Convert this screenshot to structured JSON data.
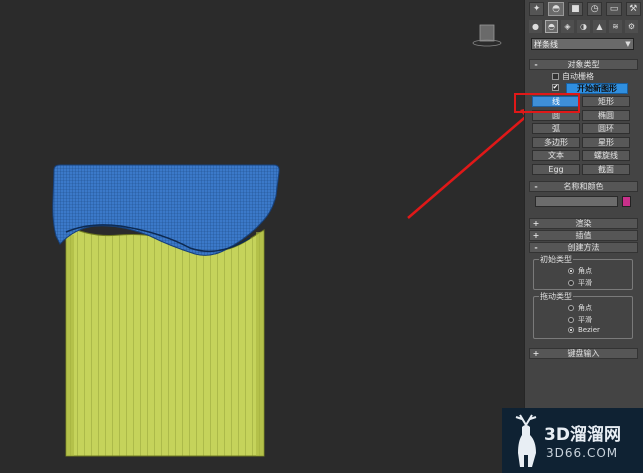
{
  "panel": {
    "tabs": [
      "✦",
      "◓",
      "■",
      "◷",
      "▭",
      "⚒"
    ],
    "subtabs": [
      "●",
      "◓",
      "◈",
      "◑",
      "▲",
      "≋",
      "⚙"
    ],
    "dropdown": {
      "value": "样条线"
    }
  },
  "object_type": {
    "title": "对象类型",
    "auto_grid": "自动栅格",
    "start_new_shape": "开始新图形",
    "buttons": [
      "线",
      "矩形",
      "圆",
      "椭圆",
      "弧",
      "圆环",
      "多边形",
      "星形",
      "文本",
      "螺旋线",
      "Egg",
      "截面"
    ]
  },
  "name_color": {
    "title": "名称和颜色",
    "swatch_color": "#c8308a"
  },
  "rollouts": {
    "render": "渲染",
    "interpolation": "插值",
    "creation_method": "创建方法",
    "keyboard_entry": "键盘输入"
  },
  "creation_method": {
    "initial_type": {
      "label": "初始类型",
      "options": [
        "角点",
        "平滑"
      ],
      "selected": "角点"
    },
    "drag_type": {
      "label": "拖动类型",
      "options": [
        "角点",
        "平滑",
        "Bezier"
      ],
      "selected": "Bezier"
    }
  },
  "viewcube": {
    "label": "前"
  },
  "watermark": {
    "brand": "3D溜溜网",
    "url": "3D66.COM"
  },
  "colors": {
    "viewport_bg": "#2b2b2b",
    "cup_body": "#c7d45a",
    "cup_lid": "#3a78c8",
    "arrow": "#e01818",
    "selected_button": "#3f8fd8"
  }
}
